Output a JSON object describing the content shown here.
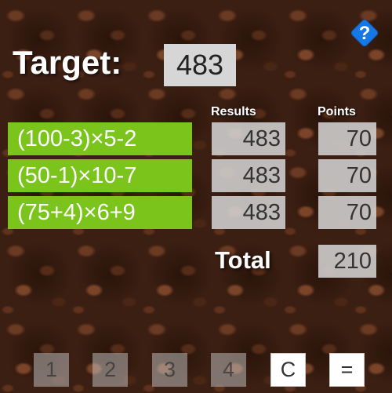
{
  "target": {
    "label": "Target:",
    "value": "483"
  },
  "help": {
    "icon": "help-icon",
    "symbol": "?",
    "color": "#1677e6"
  },
  "headers": {
    "results": "Results",
    "points": "Points"
  },
  "rows": [
    {
      "expression": "(100-3)×5-2",
      "result": "483",
      "points": "70"
    },
    {
      "expression": "(50-1)×10-7",
      "result": "483",
      "points": "70"
    },
    {
      "expression": "(75+4)×6+9",
      "result": "483",
      "points": "70"
    }
  ],
  "total": {
    "label": "Total",
    "value": "210"
  },
  "keys": {
    "k1": "1",
    "k2": "2",
    "k3": "3",
    "k4": "4",
    "clear": "C",
    "equals": "="
  },
  "colors": {
    "expression_bg": "#7ac41c",
    "help_bg": "#1677e6"
  }
}
